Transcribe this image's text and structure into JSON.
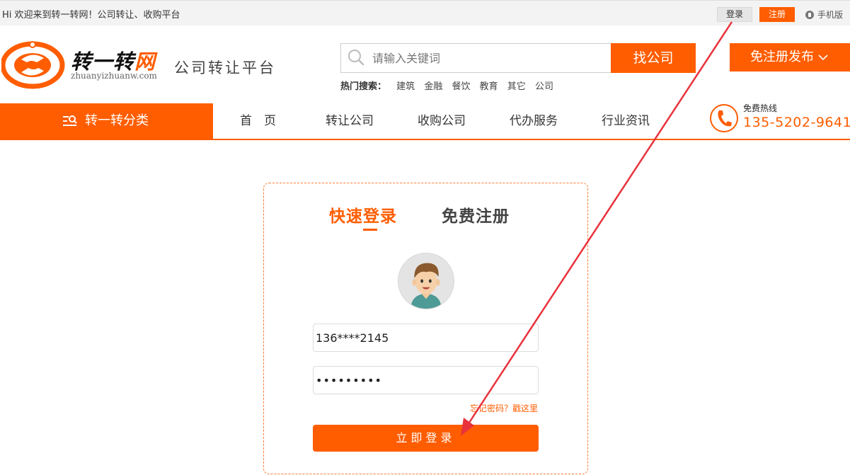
{
  "topbar": {
    "welcome": "Hi 欢迎来到转一转网！公司转让、收购平台",
    "login": "登录",
    "register": "注册",
    "mobile": "手机版"
  },
  "header": {
    "logo_name_a": "转一转",
    "logo_name_b": "网",
    "logo_url": "zhuanyizhuanw.com",
    "slogan": "公司转让平台",
    "search_placeholder": "请输入关键词",
    "search_button": "找公司",
    "publish_button": "免注册发布",
    "hot_label": "热门搜索：",
    "hot_keywords": [
      "建筑",
      "金融",
      "餐饮",
      "教育",
      "其它",
      "公司"
    ]
  },
  "nav": {
    "category": "转一转分类",
    "items": [
      "首　页",
      "转让公司",
      "收购公司",
      "代办服务",
      "行业资讯"
    ],
    "hotline_label": "免费热线",
    "hotline_number": "135-5202-9641"
  },
  "login": {
    "tab_login": "快速登录",
    "tab_register": "免费注册",
    "username": "136****2145",
    "password": "•••••••••",
    "forgot": "忘记密码？戳这里",
    "submit": "立即登录"
  },
  "colors": {
    "brand": "#ff5d00",
    "arrow": "#e8323c"
  }
}
